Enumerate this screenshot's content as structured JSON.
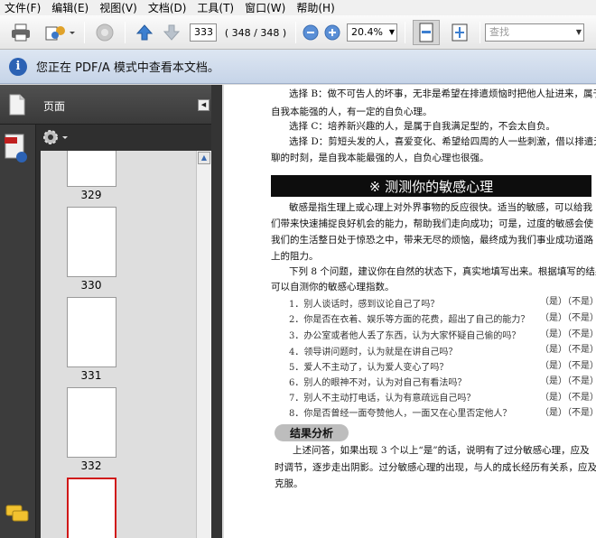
{
  "menu": [
    "文件(F)",
    "编辑(E)",
    "视图(V)",
    "文档(D)",
    "工具(T)",
    "窗口(W)",
    "帮助(H)"
  ],
  "toolbar": {
    "page_value": "333",
    "page_count": "( 348 / 348 )",
    "zoom_value": "20.4%",
    "search_placeholder": "查找"
  },
  "infobar": {
    "text": "您正在 PDF/A 模式中查看本文档。"
  },
  "nav": {
    "panel_title": "页面",
    "thumbnails": [
      "329",
      "330",
      "331",
      "332"
    ]
  },
  "document": {
    "lines": [
      "选择 B：做不可告人的坏事，无非是希望在排遣烦恼时把他人扯进来，属于",
      "自我本能强的人，有一定的自负心理。",
      "选择 C：培养新兴趣的人，是属于自我满足型的，不会太自负。",
      "选择 D：剪短头发的人，喜爱变化、希望给四周的人一些刺激，借以排遣无",
      "聊的时刻，是自我本能最强的人，自负心理也很强。"
    ],
    "heading": "※  测测你的敏感心理",
    "intro": [
      "敏感是指生理上或心理上对外界事物的反应很快。适当的敏感，可以给我",
      "们带来快速捕捉良好机会的能力，帮助我们走向成功；可是，过度的敏感会使",
      "我们的生活整日处于惊恐之中，带来无尽的烦恼，最终成为我们事业成功道路",
      "上的阻力。",
      "下列 8 个问题，建议你在自然的状态下，真实地填写出来。根据填写的结果，",
      "可以自测你的敏感心理指数。"
    ],
    "questions": [
      "1．别人谈话时，感到议论自己了吗？",
      "2．你是否在衣着、娱乐等方面的花费，超出了自己的能力？",
      "3．办公室或者他人丢了东西，认为大家怀疑自己偷的吗？",
      "4．领导讲问题时，认为就是在讲自己吗？",
      "5．爱人不主动了，认为爱人变心了吗？",
      "6．别人的眼神不对，认为对自己有看法吗？",
      "7．别人不主动打电话，认为有意疏远自己吗？",
      "8．你是否曾经一面夸赞他人，一面又在心里否定他人？"
    ],
    "answer": "（是）（不是）",
    "result_tag": "结果分析",
    "result": [
      "上述问答，如果出现 3 个以上“是”的话，说明有了过分敏感心理，应及",
      "时调节，逐步走出阴影。过分敏感心理的出现，与人的成长经历有关系，应及时",
      "克服。"
    ]
  }
}
